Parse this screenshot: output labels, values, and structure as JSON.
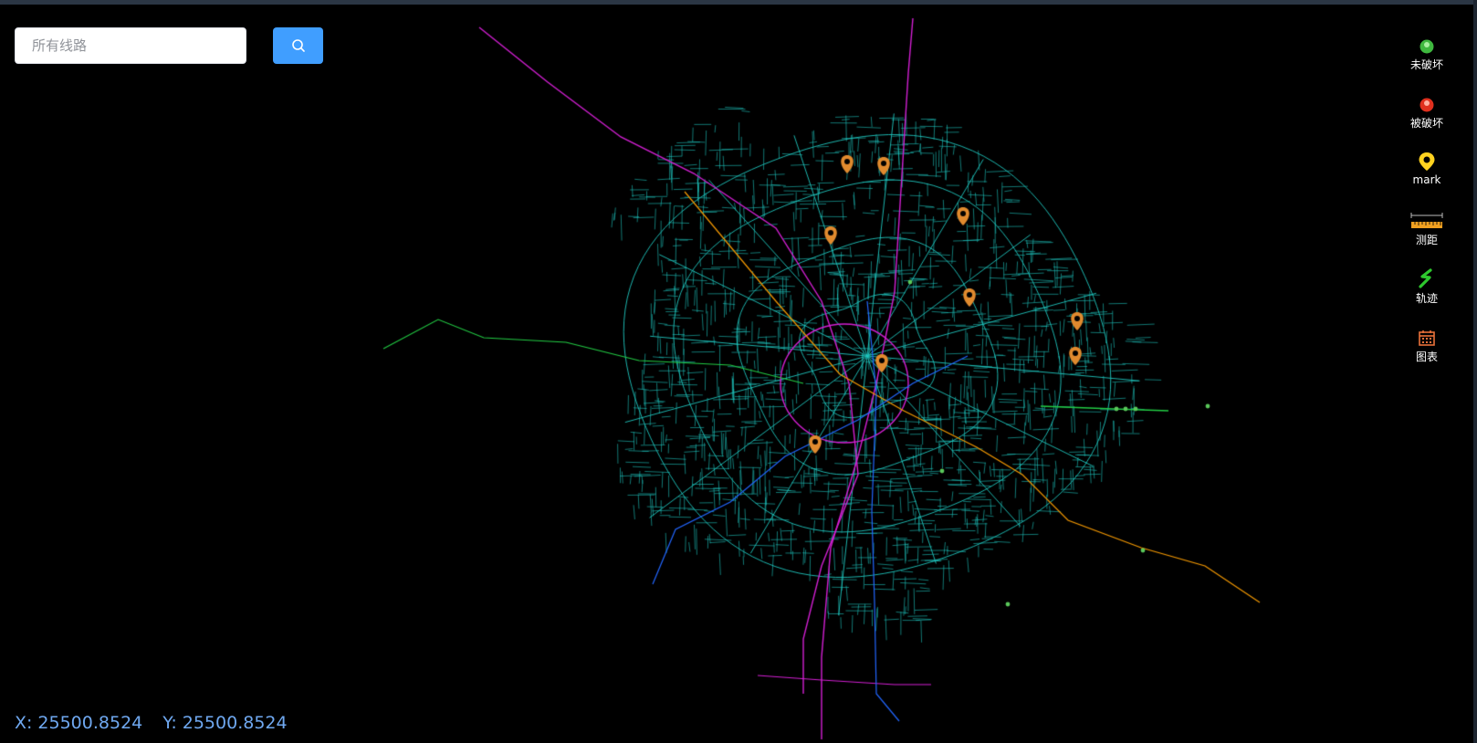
{
  "search": {
    "placeholder": "所有线路",
    "button_icon": "search-icon"
  },
  "toolbar": {
    "items": [
      {
        "label": "未破坏",
        "icon": "green-status-marker-icon",
        "color": "#3fb83f"
      },
      {
        "label": "被破坏",
        "icon": "red-status-marker-icon",
        "color": "#e0301e"
      },
      {
        "label": "mark",
        "icon": "map-pin-icon",
        "color": "#ffd21f"
      },
      {
        "label": "测距",
        "icon": "ruler-icon",
        "color": "#f0a020"
      },
      {
        "label": "轨迹",
        "icon": "track-icon",
        "color": "#2ec82e"
      },
      {
        "label": "图表",
        "icon": "calendar-chart-icon",
        "color": "#e8703a"
      }
    ]
  },
  "coords": {
    "x_label": "X:",
    "x_value": "25500.8524",
    "y_label": "Y:",
    "y_value": "25500.8524"
  },
  "map": {
    "background": "#000000",
    "road_color": "#1fc8c0",
    "line_colors": [
      "#d21fd2",
      "#f39800",
      "#2266ff",
      "#22cc44"
    ],
    "marker_color": "#e08a2e"
  }
}
